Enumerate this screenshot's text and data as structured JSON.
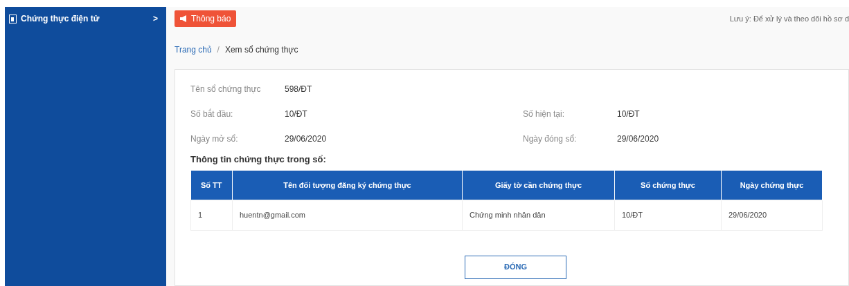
{
  "sidebar": {
    "items": [
      {
        "label": "Chứng thực điện tử",
        "chevron": ">"
      }
    ]
  },
  "notice": {
    "badge": "Thông báo",
    "text": "Lưu ý: Để xử lý và theo dõi hồ sơ d"
  },
  "breadcrumb": [
    "Trang chủ",
    "Xem sổ chứng thực"
  ],
  "breadcrumb_separator": "/",
  "fields": [
    {
      "label": "Tên sổ chứng thực",
      "value": "598/ĐT"
    },
    {
      "label": "Số bắt đầu:",
      "value": "10/ĐT"
    },
    {
      "label": "Số hiện tại:",
      "value": "10/ĐT"
    },
    {
      "label": "Ngày mở sổ:",
      "value": "29/06/2020"
    },
    {
      "label": "Ngày đóng sổ:",
      "value": "29/06/2020"
    }
  ],
  "section_title": "Thông tin chứng thực trong sổ:",
  "table": {
    "columns": [
      "Số TT",
      "Tên đối tượng đăng ký chứng thực",
      "Giấy tờ cần chứng thực",
      "Số chứng thực",
      "Ngày chứng thực"
    ],
    "rows": [
      [
        "1",
        "huentn@gmail.com",
        "Chứng minh nhân dân",
        "10/ĐT",
        "29/06/2020"
      ]
    ]
  },
  "close_button": "ĐÓNG"
}
